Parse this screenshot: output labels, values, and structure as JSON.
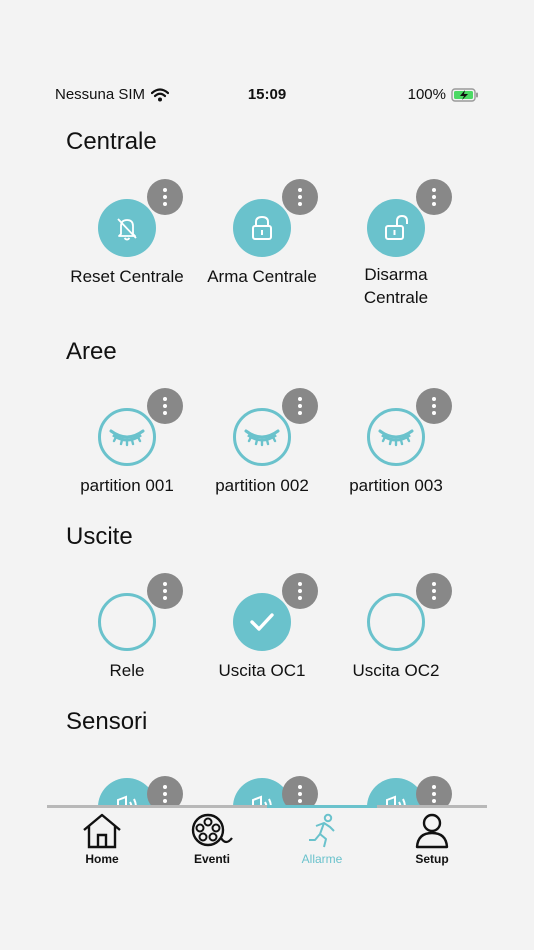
{
  "status": {
    "carrier": "Nessuna SIM",
    "time": "15:09",
    "battery": "100%"
  },
  "colors": {
    "accent": "#6ac2cc",
    "more_button": "#888888",
    "background": "#f3f3f3"
  },
  "sections": {
    "centrale": {
      "title": "Centrale",
      "tiles": [
        {
          "label": "Reset Centrale",
          "icon": "bell-off-icon"
        },
        {
          "label": "Arma Centrale",
          "icon": "lock-icon"
        },
        {
          "label": "Disarma Centrale",
          "icon": "unlock-icon"
        }
      ]
    },
    "aree": {
      "title": "Aree",
      "tiles": [
        {
          "label": "partition 001",
          "icon": "closed-eye-icon"
        },
        {
          "label": "partition 002",
          "icon": "closed-eye-icon"
        },
        {
          "label": "partition 003",
          "icon": "closed-eye-icon"
        }
      ]
    },
    "uscite": {
      "title": "Uscite",
      "tiles": [
        {
          "label": "Rele",
          "icon": "empty"
        },
        {
          "label": "Uscita OC1",
          "icon": "check-icon"
        },
        {
          "label": "Uscita OC2",
          "icon": "empty"
        }
      ]
    },
    "sensori": {
      "title": "Sensori"
    }
  },
  "tabs": [
    {
      "label": "Home",
      "icon": "home-icon"
    },
    {
      "label": "Eventi",
      "icon": "film-reel-icon"
    },
    {
      "label": "Allarme",
      "icon": "running-person-icon",
      "active": true
    },
    {
      "label": "Setup",
      "icon": "person-icon"
    }
  ]
}
